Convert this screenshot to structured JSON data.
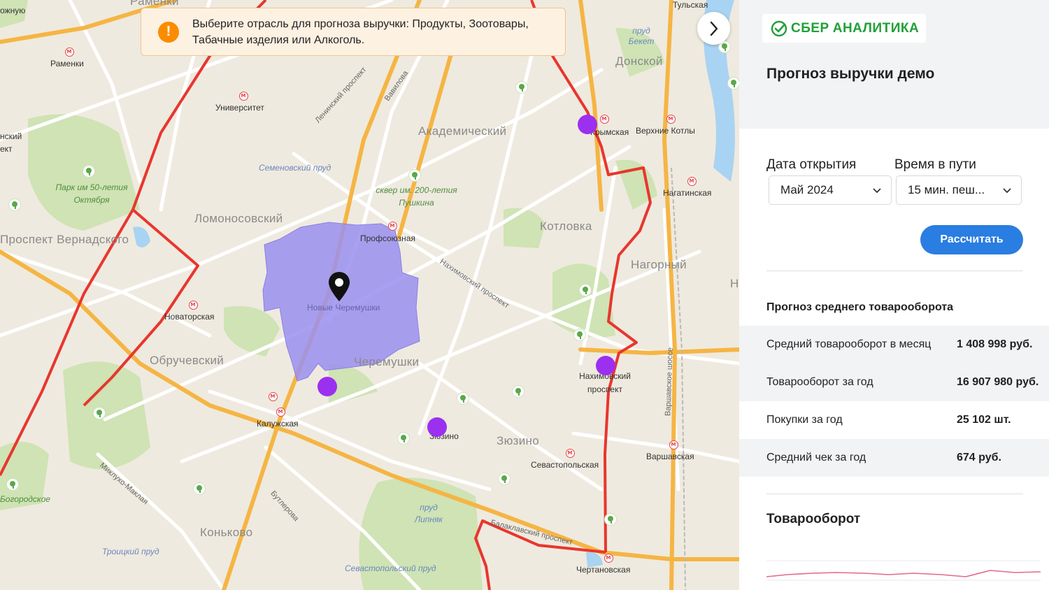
{
  "alert": {
    "icon": "warning-icon",
    "text": "Выберите отрасль для прогноза выручки: Продукты, Зоотовары, Табачные изделия или Алкоголь."
  },
  "map": {
    "districts": [
      "Академический",
      "Ломоносовский",
      "Проспект Вернадского",
      "Котловка",
      "Нагорный",
      "Обручевский",
      "Черемушки",
      "Зюзино",
      "Коньково",
      "Донской",
      "Раменки"
    ],
    "metro": [
      "Университет",
      "Профсоюзная",
      "Новые Черемушки",
      "Новаторская",
      "Калужская",
      "Зюзино",
      "Севастопольская",
      "Нахимовский проспект",
      "Варшавская",
      "Нагатинская",
      "Верхние Котлы",
      "Крымская",
      "Чертановская",
      "Тульская",
      "Раменки"
    ],
    "water": [
      "Семеновский пруд",
      "пруд Бекет",
      "пруд Липняк",
      "Троицкий пруд",
      "Севастопольский пруд"
    ],
    "parks": [
      "Парк им 50-летия Октября",
      "сквер им. 200-летия Пушкина",
      "Богородское"
    ],
    "roads": [
      "Ленинский проспект",
      "Вавилова",
      "Нахимовский проспект",
      "Варшавское шоссе",
      "Миклухо-Маклая",
      "Бутлерова",
      "Балаклавский проспект"
    ],
    "edge_fragments": [
      "ожную",
      "нский",
      "ект",
      "Н"
    ],
    "colors": {
      "isochrone": "#9a8ff0",
      "boundary": "#e8362e",
      "poi": "#9b30f0",
      "major_road": "#f5b544"
    }
  },
  "panel": {
    "logo_word1": "СБЕР",
    "logo_word2": "АНАЛИТИКА",
    "title": "Прогноз выручки демо",
    "open_date_label": "Дата открытия",
    "open_date_value": "Май 2024",
    "travel_label": "Время в пути",
    "travel_value": "15 мин. пеш...",
    "calc_button": "Рассчитать",
    "section_title": "Прогноз среднего товарооборота",
    "metrics": [
      {
        "label": "Средний товарооборот в месяц",
        "value": "1 408 998 руб."
      },
      {
        "label": "Товарооборот за год",
        "value": "16 907 980 руб."
      },
      {
        "label": "Покупки за год",
        "value": "25 102 шт."
      },
      {
        "label": "Средний чек за год",
        "value": "674 руб."
      }
    ],
    "chart_title": "Товарооборот",
    "accent_color": "#2a7de1",
    "brand_color": "#21a038"
  }
}
